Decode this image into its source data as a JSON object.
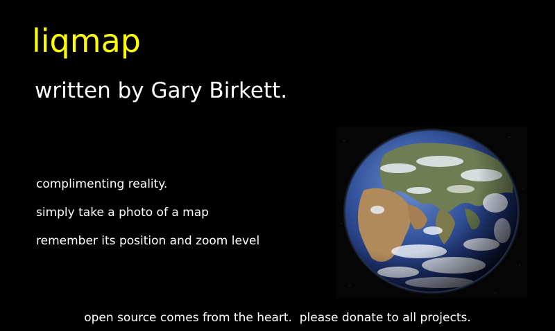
{
  "app": {
    "title": "liqmap",
    "author_line": "written by Gary Birkett."
  },
  "features": [
    "complimenting reality.",
    "simply take a photo of a map",
    "remember its position and zoom level"
  ],
  "globe": {
    "icon": "earth-globe-icon"
  },
  "footer": {
    "text": "open source comes from the heart.  please donate to all projects."
  },
  "colors": {
    "background": "#000000",
    "title": "#ffff00",
    "text": "#ffffff"
  }
}
